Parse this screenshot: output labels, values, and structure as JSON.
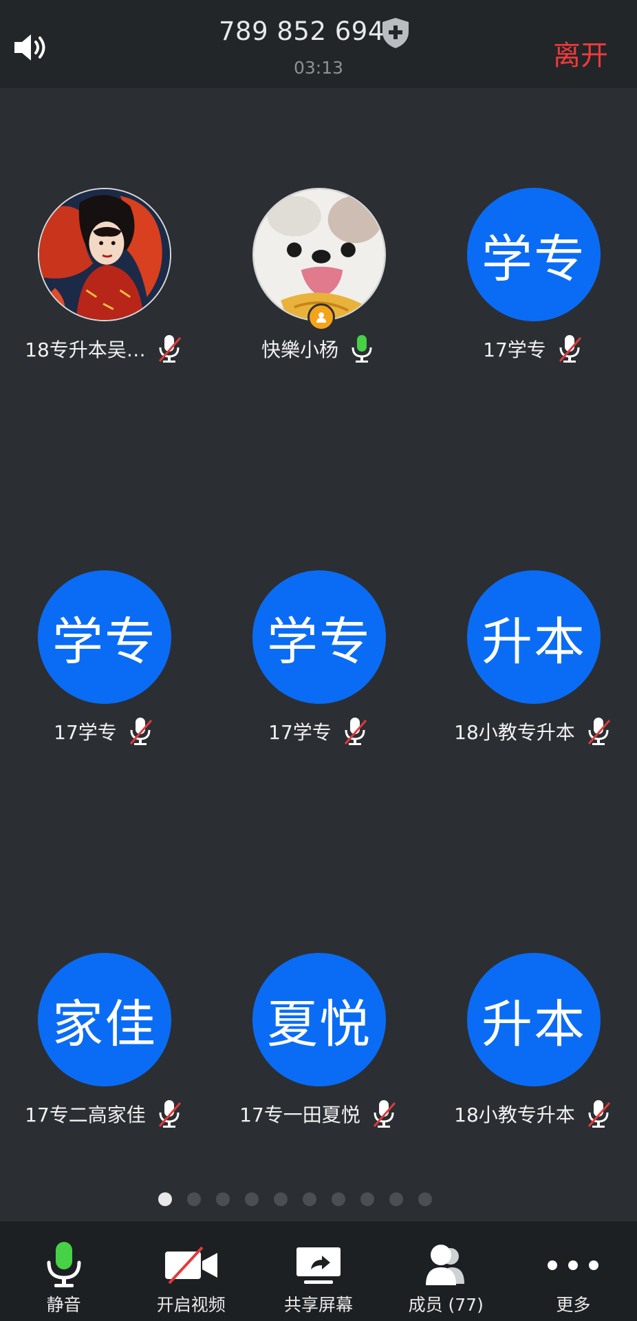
{
  "header": {
    "meeting_id": "789 852 694",
    "timer": "03:13",
    "leave_label": "离开",
    "speaker_icon": "speaker-icon",
    "security_icon": "shield-plus-icon"
  },
  "participants": [
    {
      "name": "18专升本吴…",
      "avatar_text": "",
      "avatar_type": "photo-anime",
      "mic": "muted"
    },
    {
      "name": "快樂小杨",
      "avatar_text": "",
      "avatar_type": "photo-dog",
      "mic": "active",
      "host": true
    },
    {
      "name": "17学专",
      "avatar_text": "学专",
      "avatar_type": "initials",
      "mic": "muted"
    },
    {
      "name": "17学专",
      "avatar_text": "学专",
      "avatar_type": "initials",
      "mic": "muted"
    },
    {
      "name": "17学专",
      "avatar_text": "学专",
      "avatar_type": "initials",
      "mic": "muted"
    },
    {
      "name": "18小教专升本",
      "avatar_text": "升本",
      "avatar_type": "initials",
      "mic": "muted"
    },
    {
      "name": "17专二高家佳",
      "avatar_text": "家佳",
      "avatar_type": "initials",
      "mic": "muted"
    },
    {
      "name": "17专一田夏悦",
      "avatar_text": "夏悦",
      "avatar_type": "initials",
      "mic": "muted"
    },
    {
      "name": "18小教专升本",
      "avatar_text": "升本",
      "avatar_type": "initials",
      "mic": "muted"
    }
  ],
  "pagination": {
    "total_pages": 10,
    "current_page": 1
  },
  "toolbar": {
    "mute_label": "静音",
    "video_label": "开启视频",
    "share_label": "共享屏幕",
    "members_label": "成员 (77)",
    "more_label": "更多"
  },
  "colors": {
    "avatar_blue": "#0a6cf5",
    "leave_red": "#ef3b3b",
    "mic_green": "#46d146",
    "muted_red": "#e23a3a",
    "host_orange": "#f5a31a",
    "background": "#2b2f33"
  }
}
